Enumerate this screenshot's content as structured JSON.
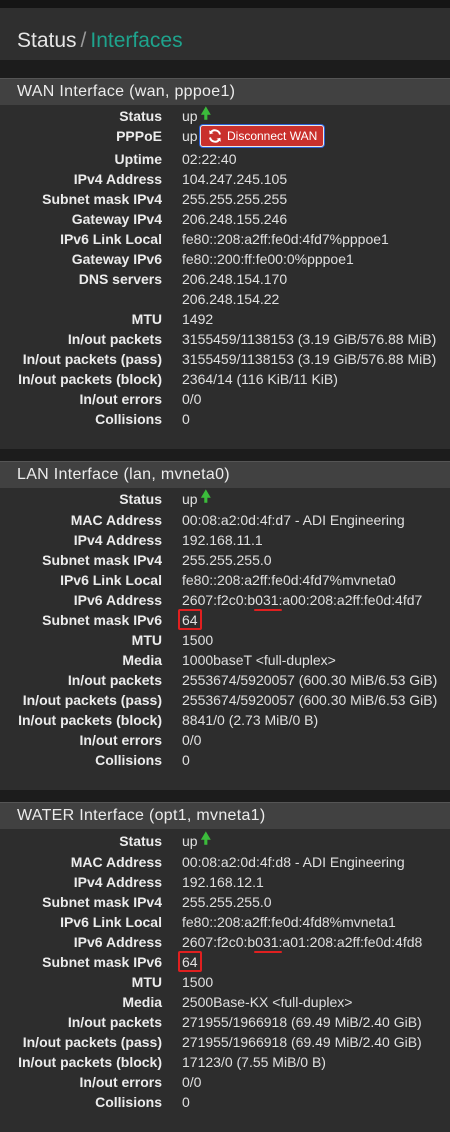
{
  "breadcrumb": {
    "parent": "Status",
    "separator": "/",
    "current": "Interfaces"
  },
  "colors": {
    "accent": "#1ea38d",
    "up_arrow": "#3bbb3b",
    "danger": "#c9302c",
    "annotation": "#e02020"
  },
  "wan": {
    "title": "WAN Interface (wan, pppoe1)",
    "status": {
      "label": "Status",
      "value": "up",
      "icon": "arrow-up-icon"
    },
    "pppoe": {
      "label": "PPPoE",
      "value": "up",
      "button": "Disconnect WAN",
      "button_icon": "refresh-icon"
    },
    "uptime": {
      "label": "Uptime",
      "value": "02:22:40"
    },
    "ipv4": {
      "label": "IPv4 Address",
      "value": "104.247.245.105"
    },
    "subnet4": {
      "label": "Subnet mask IPv4",
      "value": "255.255.255.255"
    },
    "gw4": {
      "label": "Gateway IPv4",
      "value": "206.248.155.246"
    },
    "ll6": {
      "label": "IPv6 Link Local",
      "value": "fe80::208:a2ff:fe0d:4fd7%pppoe1"
    },
    "gw6": {
      "label": "Gateway IPv6",
      "value": "fe80::200:ff:fe00:0%pppoe1"
    },
    "dns": {
      "label": "DNS servers",
      "values": [
        "206.248.154.170",
        "206.248.154.22"
      ]
    },
    "mtu": {
      "label": "MTU",
      "value": "1492"
    },
    "io": {
      "label": "In/out packets",
      "value": "3155459/1138153 (3.19 GiB/576.88 MiB)"
    },
    "io_pass": {
      "label": "In/out packets (pass)",
      "value": "3155459/1138153 (3.19 GiB/576.88 MiB)"
    },
    "io_block": {
      "label": "In/out packets (block)",
      "value": "2364/14 (116 KiB/11 KiB)"
    },
    "errors": {
      "label": "In/out errors",
      "value": "0/0"
    },
    "collisions": {
      "label": "Collisions",
      "value": "0"
    }
  },
  "lan": {
    "title": "LAN Interface (lan, mvneta0)",
    "status": {
      "label": "Status",
      "value": "up",
      "icon": "arrow-up-icon"
    },
    "mac": {
      "label": "MAC Address",
      "value": "00:08:a2:0d:4f:d7 - ADI Engineering"
    },
    "ipv4": {
      "label": "IPv4 Address",
      "value": "192.168.11.1"
    },
    "subnet4": {
      "label": "Subnet mask IPv4",
      "value": "255.255.255.0"
    },
    "ll6": {
      "label": "IPv6 Link Local",
      "value": "fe80::208:a2ff:fe0d:4fd7%mvneta0"
    },
    "ipv6": {
      "label": "IPv6 Address",
      "value": "2607:f2c0:b031:a00:208:a2ff:fe0d:4fd7"
    },
    "subnet6": {
      "label": "Subnet mask IPv6",
      "value": "64"
    },
    "mtu": {
      "label": "MTU",
      "value": "1500"
    },
    "media": {
      "label": "Media",
      "value": "1000baseT <full-duplex>"
    },
    "io": {
      "label": "In/out packets",
      "value": "2553674/5920057 (600.30 MiB/6.53 GiB)"
    },
    "io_pass": {
      "label": "In/out packets (pass)",
      "value": "2553674/5920057 (600.30 MiB/6.53 GiB)"
    },
    "io_block": {
      "label": "In/out packets (block)",
      "value": "8841/0 (2.73 MiB/0 B)"
    },
    "errors": {
      "label": "In/out errors",
      "value": "0/0"
    },
    "collisions": {
      "label": "Collisions",
      "value": "0"
    }
  },
  "water": {
    "title": "WATER Interface (opt1, mvneta1)",
    "status": {
      "label": "Status",
      "value": "up",
      "icon": "arrow-up-icon"
    },
    "mac": {
      "label": "MAC Address",
      "value": "00:08:a2:0d:4f:d8 - ADI Engineering"
    },
    "ipv4": {
      "label": "IPv4 Address",
      "value": "192.168.12.1"
    },
    "subnet4": {
      "label": "Subnet mask IPv4",
      "value": "255.255.255.0"
    },
    "ll6": {
      "label": "IPv6 Link Local",
      "value": "fe80::208:a2ff:fe0d:4fd8%mvneta1"
    },
    "ipv6": {
      "label": "IPv6 Address",
      "value": "2607:f2c0:b031:a01:208:a2ff:fe0d:4fd8"
    },
    "subnet6": {
      "label": "Subnet mask IPv6",
      "value": "64"
    },
    "mtu": {
      "label": "MTU",
      "value": "1500"
    },
    "media": {
      "label": "Media",
      "value": "2500Base-KX <full-duplex>"
    },
    "io": {
      "label": "In/out packets",
      "value": "271955/1966918 (69.49 MiB/2.40 GiB)"
    },
    "io_pass": {
      "label": "In/out packets (pass)",
      "value": "271955/1966918 (69.49 MiB/2.40 GiB)"
    },
    "io_block": {
      "label": "In/out packets (block)",
      "value": "17123/0 (7.55 MiB/0 B)"
    },
    "errors": {
      "label": "In/out errors",
      "value": "0/0"
    },
    "collisions": {
      "label": "Collisions",
      "value": "0"
    }
  }
}
